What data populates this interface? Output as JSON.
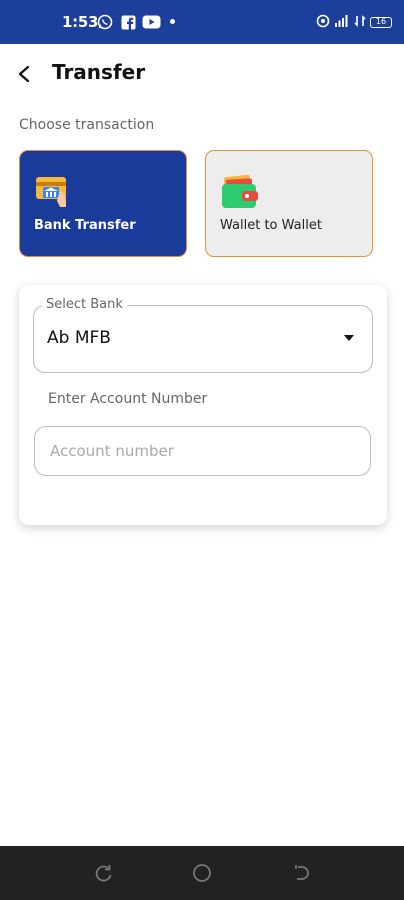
{
  "status_bar": {
    "time": "1:53",
    "battery": "16",
    "icons": [
      "whatsapp-icon",
      "facebook-icon",
      "youtube-icon",
      "notification-dot",
      "hotspot-icon",
      "signal-icon",
      "data-icon",
      "battery-icon"
    ]
  },
  "header": {
    "title": "Transfer"
  },
  "section_label": "Choose transaction",
  "transaction_types": [
    {
      "label": "Bank Transfer",
      "icon": "bank-card-icon",
      "selected": true
    },
    {
      "label": "Wallet to Wallet",
      "icon": "wallet-icon",
      "selected": false
    }
  ],
  "form": {
    "bank_select": {
      "legend": "Select Bank",
      "value": "Ab MFB"
    },
    "account": {
      "label": "Enter Account Number",
      "placeholder": "Account number",
      "value": ""
    }
  },
  "colors": {
    "primary": "#1d3f9c",
    "accent_border": "#e8923f",
    "nav_background": "#222222"
  },
  "nav": [
    "recent-apps-icon",
    "home-icon",
    "back-nav-icon"
  ]
}
